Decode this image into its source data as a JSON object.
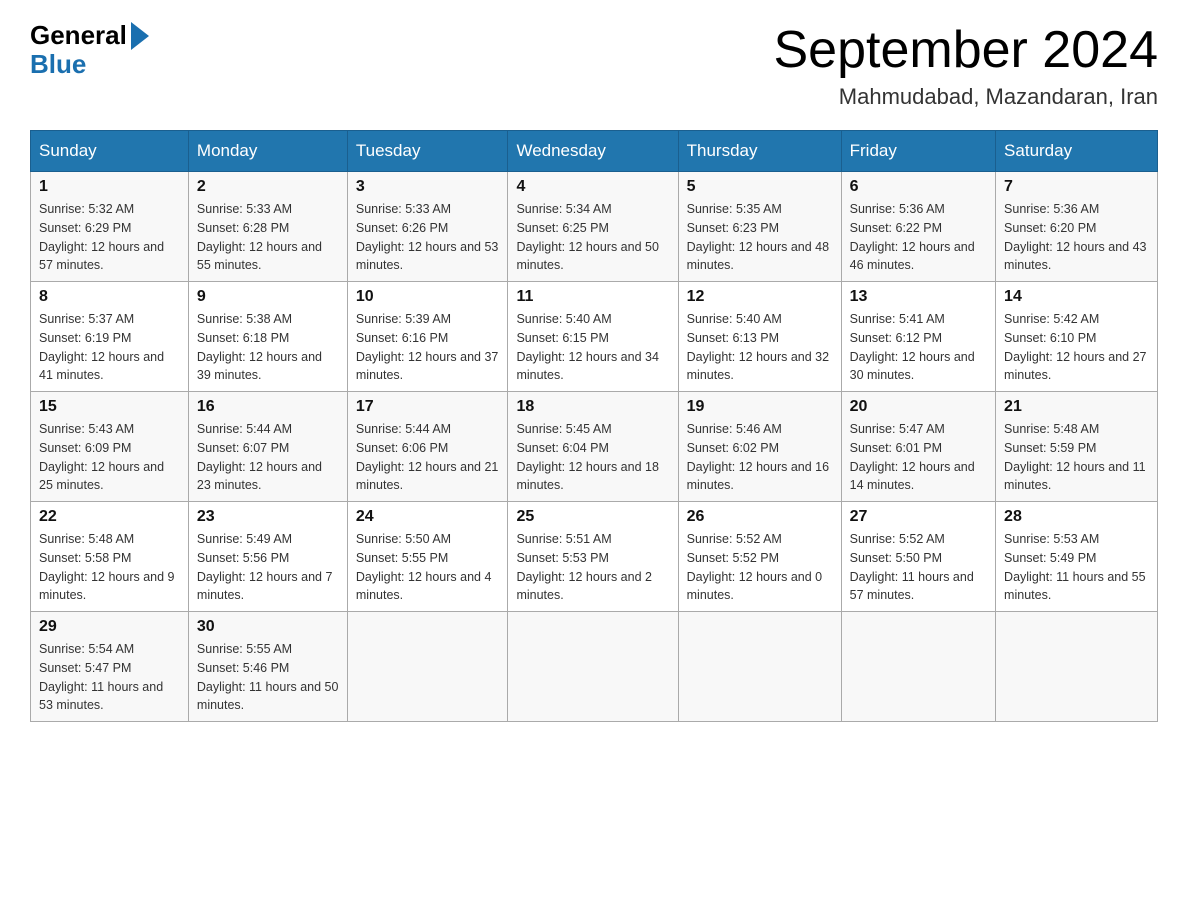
{
  "header": {
    "logo_general": "General",
    "logo_blue": "Blue",
    "title": "September 2024",
    "location": "Mahmudabad, Mazandaran, Iran"
  },
  "days_of_week": [
    "Sunday",
    "Monday",
    "Tuesday",
    "Wednesday",
    "Thursday",
    "Friday",
    "Saturday"
  ],
  "weeks": [
    [
      {
        "day": "1",
        "sunrise": "5:32 AM",
        "sunset": "6:29 PM",
        "daylight": "12 hours and 57 minutes."
      },
      {
        "day": "2",
        "sunrise": "5:33 AM",
        "sunset": "6:28 PM",
        "daylight": "12 hours and 55 minutes."
      },
      {
        "day": "3",
        "sunrise": "5:33 AM",
        "sunset": "6:26 PM",
        "daylight": "12 hours and 53 minutes."
      },
      {
        "day": "4",
        "sunrise": "5:34 AM",
        "sunset": "6:25 PM",
        "daylight": "12 hours and 50 minutes."
      },
      {
        "day": "5",
        "sunrise": "5:35 AM",
        "sunset": "6:23 PM",
        "daylight": "12 hours and 48 minutes."
      },
      {
        "day": "6",
        "sunrise": "5:36 AM",
        "sunset": "6:22 PM",
        "daylight": "12 hours and 46 minutes."
      },
      {
        "day": "7",
        "sunrise": "5:36 AM",
        "sunset": "6:20 PM",
        "daylight": "12 hours and 43 minutes."
      }
    ],
    [
      {
        "day": "8",
        "sunrise": "5:37 AM",
        "sunset": "6:19 PM",
        "daylight": "12 hours and 41 minutes."
      },
      {
        "day": "9",
        "sunrise": "5:38 AM",
        "sunset": "6:18 PM",
        "daylight": "12 hours and 39 minutes."
      },
      {
        "day": "10",
        "sunrise": "5:39 AM",
        "sunset": "6:16 PM",
        "daylight": "12 hours and 37 minutes."
      },
      {
        "day": "11",
        "sunrise": "5:40 AM",
        "sunset": "6:15 PM",
        "daylight": "12 hours and 34 minutes."
      },
      {
        "day": "12",
        "sunrise": "5:40 AM",
        "sunset": "6:13 PM",
        "daylight": "12 hours and 32 minutes."
      },
      {
        "day": "13",
        "sunrise": "5:41 AM",
        "sunset": "6:12 PM",
        "daylight": "12 hours and 30 minutes."
      },
      {
        "day": "14",
        "sunrise": "5:42 AM",
        "sunset": "6:10 PM",
        "daylight": "12 hours and 27 minutes."
      }
    ],
    [
      {
        "day": "15",
        "sunrise": "5:43 AM",
        "sunset": "6:09 PM",
        "daylight": "12 hours and 25 minutes."
      },
      {
        "day": "16",
        "sunrise": "5:44 AM",
        "sunset": "6:07 PM",
        "daylight": "12 hours and 23 minutes."
      },
      {
        "day": "17",
        "sunrise": "5:44 AM",
        "sunset": "6:06 PM",
        "daylight": "12 hours and 21 minutes."
      },
      {
        "day": "18",
        "sunrise": "5:45 AM",
        "sunset": "6:04 PM",
        "daylight": "12 hours and 18 minutes."
      },
      {
        "day": "19",
        "sunrise": "5:46 AM",
        "sunset": "6:02 PM",
        "daylight": "12 hours and 16 minutes."
      },
      {
        "day": "20",
        "sunrise": "5:47 AM",
        "sunset": "6:01 PM",
        "daylight": "12 hours and 14 minutes."
      },
      {
        "day": "21",
        "sunrise": "5:48 AM",
        "sunset": "5:59 PM",
        "daylight": "12 hours and 11 minutes."
      }
    ],
    [
      {
        "day": "22",
        "sunrise": "5:48 AM",
        "sunset": "5:58 PM",
        "daylight": "12 hours and 9 minutes."
      },
      {
        "day": "23",
        "sunrise": "5:49 AM",
        "sunset": "5:56 PM",
        "daylight": "12 hours and 7 minutes."
      },
      {
        "day": "24",
        "sunrise": "5:50 AM",
        "sunset": "5:55 PM",
        "daylight": "12 hours and 4 minutes."
      },
      {
        "day": "25",
        "sunrise": "5:51 AM",
        "sunset": "5:53 PM",
        "daylight": "12 hours and 2 minutes."
      },
      {
        "day": "26",
        "sunrise": "5:52 AM",
        "sunset": "5:52 PM",
        "daylight": "12 hours and 0 minutes."
      },
      {
        "day": "27",
        "sunrise": "5:52 AM",
        "sunset": "5:50 PM",
        "daylight": "11 hours and 57 minutes."
      },
      {
        "day": "28",
        "sunrise": "5:53 AM",
        "sunset": "5:49 PM",
        "daylight": "11 hours and 55 minutes."
      }
    ],
    [
      {
        "day": "29",
        "sunrise": "5:54 AM",
        "sunset": "5:47 PM",
        "daylight": "11 hours and 53 minutes."
      },
      {
        "day": "30",
        "sunrise": "5:55 AM",
        "sunset": "5:46 PM",
        "daylight": "11 hours and 50 minutes."
      },
      null,
      null,
      null,
      null,
      null
    ]
  ]
}
